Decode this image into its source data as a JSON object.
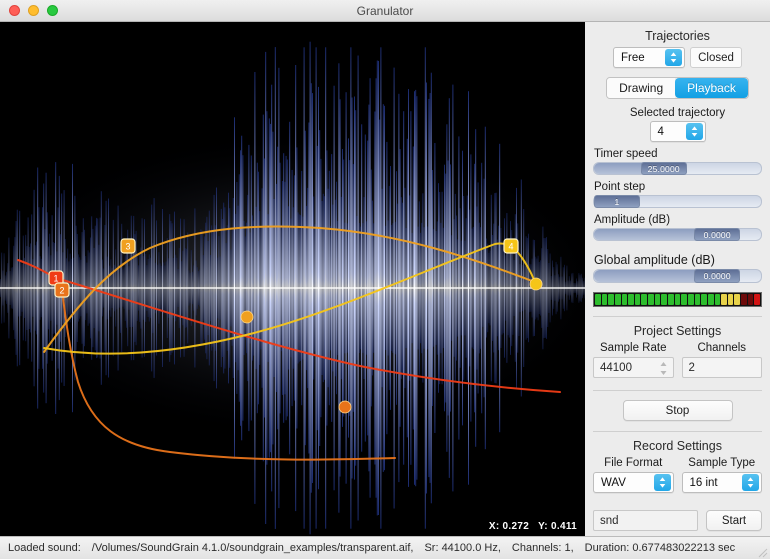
{
  "window": {
    "title": "Granulator",
    "controls": [
      "close",
      "minimize",
      "maximize"
    ]
  },
  "canvas": {
    "coord_x": "X: 0.272",
    "coord_y": "Y: 0.411",
    "background": "#000000",
    "waveform_color": "#dfe6ff",
    "trajectories": [
      {
        "id": "1",
        "color": "#f03c16",
        "label": "1"
      },
      {
        "id": "2",
        "color": "#e8731a",
        "label": "2"
      },
      {
        "id": "3",
        "color": "#f0a020",
        "label": "3"
      },
      {
        "id": "4",
        "color": "#f5c518",
        "label": "4"
      }
    ]
  },
  "panel": {
    "trajectories": {
      "title": "Trajectories",
      "type_value": "Free",
      "closed_label": "Closed",
      "mode_options": [
        "Drawing",
        "Playback"
      ],
      "mode_selected": "Playback",
      "selected_trajectory_label": "Selected trajectory",
      "selected_trajectory_value": "4"
    },
    "sliders": [
      {
        "label": "Timer speed",
        "value": "25.0000",
        "percent": 35
      },
      {
        "label": "Point step",
        "value": "1",
        "percent": 3
      },
      {
        "label": "Amplitude (dB)",
        "value": "0.0000",
        "percent": 72
      }
    ],
    "global_amplitude": {
      "label": "Global amplitude (dB)",
      "value": "0.0000",
      "percent": 72
    },
    "vu_meter": {
      "green": "#2dbd2d",
      "yellow": "#e8d24a",
      "dark_red": "#6d0a0a",
      "red": "#d21414",
      "segments": 25,
      "green_count": 19,
      "yellow_count": 3
    },
    "project_settings": {
      "title": "Project Settings",
      "sample_rate_label": "Sample Rate",
      "sample_rate_value": "44100",
      "channels_label": "Channels",
      "channels_value": "2"
    },
    "transport": {
      "stop_label": "Stop"
    },
    "record_settings": {
      "title": "Record Settings",
      "file_format_label": "File Format",
      "file_format_value": "WAV",
      "sample_type_label": "Sample Type",
      "sample_type_value": "16 int",
      "filename_value": "snd",
      "start_label": "Start"
    },
    "accent_blue": "#22a7e8"
  },
  "statusbar": {
    "loaded_label": "Loaded sound:",
    "path": "/Volumes/SoundGrain 4.1.0/soundgrain_examples/transparent.aif,",
    "sample_rate": "Sr: 44100.0 Hz,",
    "channels": "Channels: 1,",
    "duration": "Duration: 0.677483022213 sec"
  }
}
